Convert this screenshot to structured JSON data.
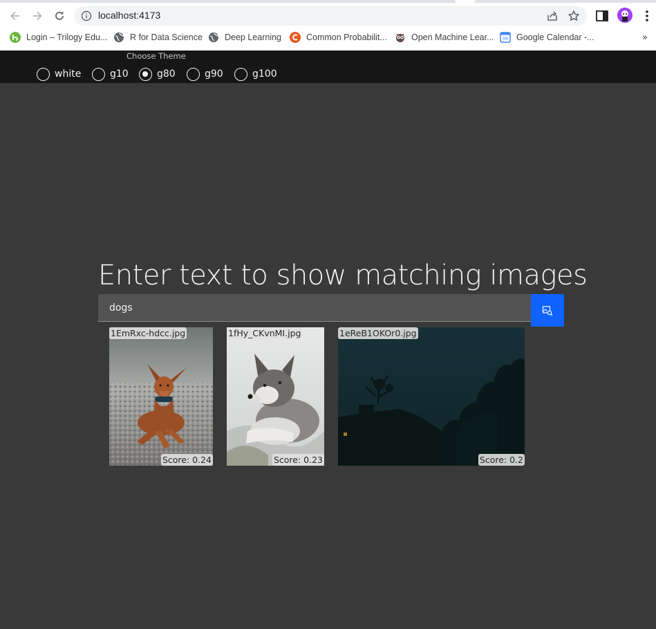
{
  "browser": {
    "url": "localhost:4173",
    "bookmarks": [
      {
        "label": "Login – Trilogy Edu...",
        "icon": "trilogy-favicon"
      },
      {
        "label": "R for Data Science",
        "icon": "globe-icon"
      },
      {
        "label": "Deep Learning",
        "icon": "globe-icon"
      },
      {
        "label": "Common Probabilit...",
        "icon": "c-favicon"
      },
      {
        "label": "Open Machine Lear...",
        "icon": "owl-favicon"
      },
      {
        "label": "Google Calendar -...",
        "icon": "calendar-favicon"
      }
    ],
    "more_bookmarks": "»"
  },
  "theme": {
    "legend": "Choose Theme",
    "options": [
      "white",
      "g10",
      "g80",
      "g90",
      "g100"
    ],
    "selected": "g80"
  },
  "search": {
    "heading": "Enter text to show matching images",
    "value": "dogs",
    "button_icon": "image-search-icon"
  },
  "results": [
    {
      "filename": "1EmRxc-hdcc.jpg",
      "score": "Score: 0.24",
      "subject": "red dog lying on gravel"
    },
    {
      "filename": "1fHy_CKvnMI.jpg",
      "score": "Score: 0.23",
      "subject": "grey wolf puppy in snow"
    },
    {
      "filename": "1eReB1OKOr0.jpg",
      "score": "Score: 0.2",
      "subject": "dark night silhouette of house and trees"
    }
  ],
  "colors": {
    "page_bg": "#393939",
    "header_bg": "#161616",
    "accent": "#0f62fe",
    "field_bg": "#525252"
  }
}
